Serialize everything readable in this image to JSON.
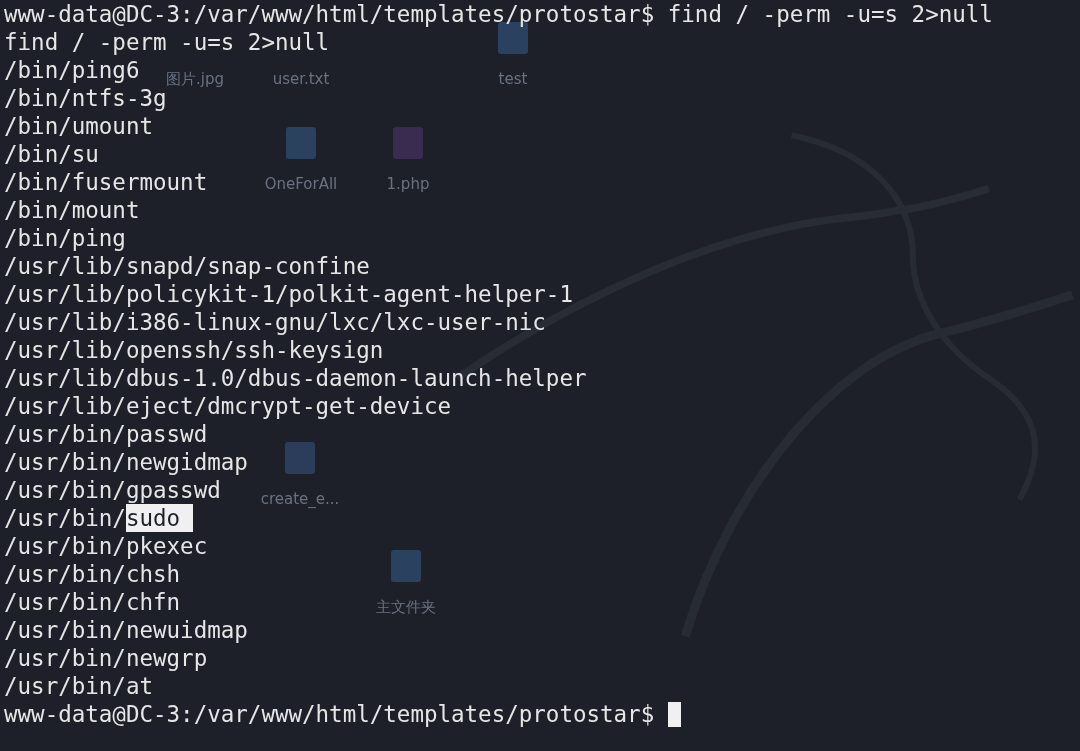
{
  "desktop": {
    "icons": [
      {
        "label": "图片.jpg"
      },
      {
        "label": "user.txt"
      },
      {
        "label": "test",
        "kind": "folder"
      },
      {
        "label": "OneForAll",
        "kind": "folder"
      },
      {
        "label": "1.php",
        "kind": "php"
      },
      {
        "label": "create_e...",
        "kind": "python"
      },
      {
        "label": "主文件夹",
        "kind": "home"
      }
    ]
  },
  "terminal": {
    "lines": [
      {
        "text": "www-data@DC-3:/var/www/html/templates/protostar$ find / -perm -u=s 2>null"
      },
      {
        "text": "find / -perm -u=s 2>null"
      },
      {
        "text": "/bin/ping6"
      },
      {
        "text": "/bin/ntfs-3g"
      },
      {
        "text": "/bin/umount"
      },
      {
        "text": "/bin/su"
      },
      {
        "text": "/bin/fusermount"
      },
      {
        "text": "/bin/mount"
      },
      {
        "text": "/bin/ping"
      },
      {
        "text": "/usr/lib/snapd/snap-confine"
      },
      {
        "text": "/usr/lib/policykit-1/polkit-agent-helper-1"
      },
      {
        "text": "/usr/lib/i386-linux-gnu/lxc/lxc-user-nic"
      },
      {
        "text": "/usr/lib/openssh/ssh-keysign"
      },
      {
        "text": "/usr/lib/dbus-1.0/dbus-daemon-launch-helper"
      },
      {
        "text": "/usr/lib/eject/dmcrypt-get-device"
      },
      {
        "text": "/usr/bin/passwd"
      },
      {
        "text": "/usr/bin/newgidmap"
      },
      {
        "text": "/usr/bin/gpasswd"
      },
      {
        "text": "/usr/bin/",
        "selection": "sudo"
      },
      {
        "text": "/usr/bin/pkexec"
      },
      {
        "text": "/usr/bin/chsh"
      },
      {
        "text": "/usr/bin/chfn"
      },
      {
        "text": "/usr/bin/newuidmap"
      },
      {
        "text": "/usr/bin/newgrp"
      },
      {
        "text": "/usr/bin/at"
      }
    ],
    "prompt": "www-data@DC-3:/var/www/html/templates/protostar$"
  }
}
